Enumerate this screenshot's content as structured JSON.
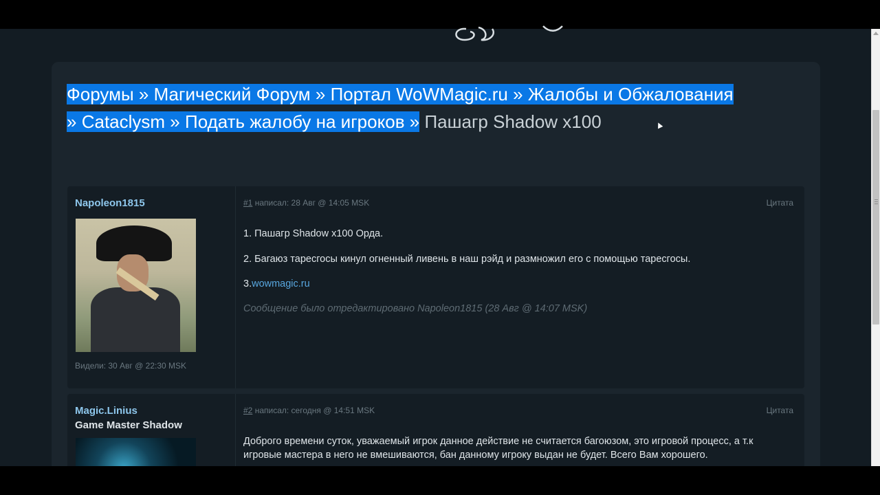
{
  "breadcrumb": {
    "items": [
      "Форумы",
      "Магический Форум",
      "Портал WoWMagic.ru",
      "Жалобы и Обжалования",
      "Cataclysm",
      "Подать жалобу на игроков"
    ],
    "separator": "»",
    "current": "Пашагр Shadow x100"
  },
  "posts": [
    {
      "author": "Napoleon1815",
      "last_seen": "Видели: 30 Авг @ 22:30 MSK",
      "number": "#1",
      "meta": " написал: 28 Авг @ 14:05 MSK",
      "quote_label": "Цитата",
      "lines": [
        "1. Пашагр Shadow x100 Орда.",
        "2. Багаюз таресгосы кинул огненный ливень в наш рэйд и размножил его с помощью таресгосы."
      ],
      "line3_prefix": "3.",
      "line3_link": "wowmagic.ru",
      "edited_note": "Сообщение было отредактировано Napoleon1815 (28 Авг @ 14:07 MSK)"
    },
    {
      "author": "Magic.Linius",
      "rank": "Game Master Shadow",
      "number": "#2",
      "meta": " написал: сегодня @ 14:51 MSK",
      "quote_label": "Цитата",
      "text": "Доброго времени суток, уважаемый игрок данное действие не считается багоюзом, это игровой процесс, а т.к игровые мастера в него не вмешиваются, бан данному игроку выдан не будет. Всего Вам хорошего."
    }
  ],
  "colors": {
    "page_bg": "#131c23",
    "panel_bg": "#1b252d",
    "selection": "#0a78e6",
    "author": "#8ec7ec",
    "link": "#58a7e0"
  }
}
